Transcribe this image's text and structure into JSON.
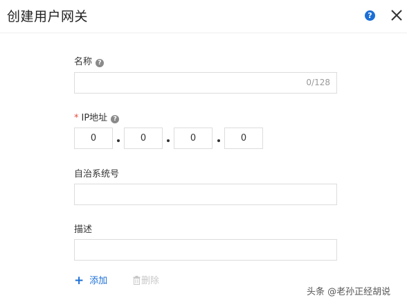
{
  "header": {
    "title": "创建用户网关",
    "help_icon": "help-circle-icon",
    "close_icon": "close-icon",
    "help_glyph": "?"
  },
  "form": {
    "name": {
      "label": "名称",
      "value": "",
      "counter": "0/128"
    },
    "ip": {
      "required_mark": "*",
      "label": "IP地址",
      "octets": [
        "0",
        "0",
        "0",
        "0"
      ]
    },
    "asn": {
      "label": "自治系统号",
      "value": ""
    },
    "description": {
      "label": "描述",
      "value": ""
    }
  },
  "actions": {
    "add_icon": "+",
    "add_label": "添加",
    "delete_label": "删除",
    "delete_icon": "trash-icon"
  },
  "watermark": "头条 @老孙正经胡说",
  "colors": {
    "accent": "#1c6fd6",
    "required": "#e84c3d",
    "border": "#dcdcdc",
    "disabled": "#c8c8c8"
  }
}
